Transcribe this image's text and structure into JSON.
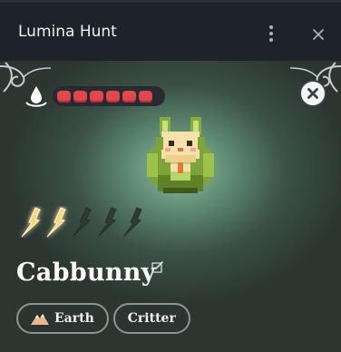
{
  "window": {
    "title": "Lumina Hunt",
    "menu_icon": "more-vertical-icon",
    "close_icon": "close-icon"
  },
  "card": {
    "energy": {
      "icon": "water-drop-icon",
      "filled": 6,
      "total": 6,
      "color": "#e1474f"
    },
    "dismiss_icon": "close-circle-icon",
    "creature_image": "cabbunny-sprite",
    "rarity": {
      "filled": 2,
      "total": 5,
      "filled_color": "#f7d77a",
      "empty_color": "#2f3a36"
    },
    "name": "Cabbunny",
    "edit_icon": "edit-icon",
    "tags": [
      {
        "label": "Earth",
        "icon": "mountain-icon"
      },
      {
        "label": "Critter"
      }
    ]
  },
  "colors": {
    "header_bg": "#1d222b",
    "card_glow": "#8fbd9f",
    "text": "#ffffff"
  }
}
